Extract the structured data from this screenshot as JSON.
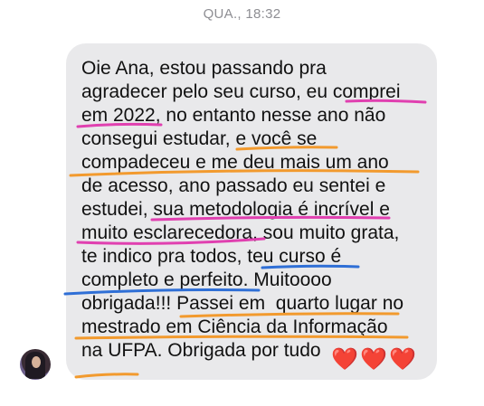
{
  "header": {
    "timestamp": "QUA., 18:32"
  },
  "message": {
    "lines": [
      "Oie Ana, estou passando pra",
      "agradecer pelo seu curso, eu comprei",
      "em 2022, no entanto nesse ano não",
      "consegui estudar, e você se",
      "compadeceu e me deu mais um ano",
      "de acesso, ano passado eu sentei e",
      "estudei, sua metodologia é incrível e",
      "muito esclarecedora, sou muito grata,",
      "te indico pra todos, teu curso é",
      "completo e perfeito. Muitoooo",
      "obrigada!!! Passei em  quarto lugar no",
      "mestrado em Ciência da Informação",
      "na UFPA. Obrigada por tudo"
    ],
    "hearts": [
      "❤️",
      "❤️",
      "❤️"
    ]
  },
  "colors": {
    "bubble": "#e9e9eb",
    "timestamp": "#8e8e93",
    "underline_pink": "#e040b0",
    "underline_orange": "#f29a2e",
    "underline_blue": "#2f6fd6",
    "heart": "#e3202c"
  },
  "avatar": {
    "icon": "sender-avatar"
  }
}
